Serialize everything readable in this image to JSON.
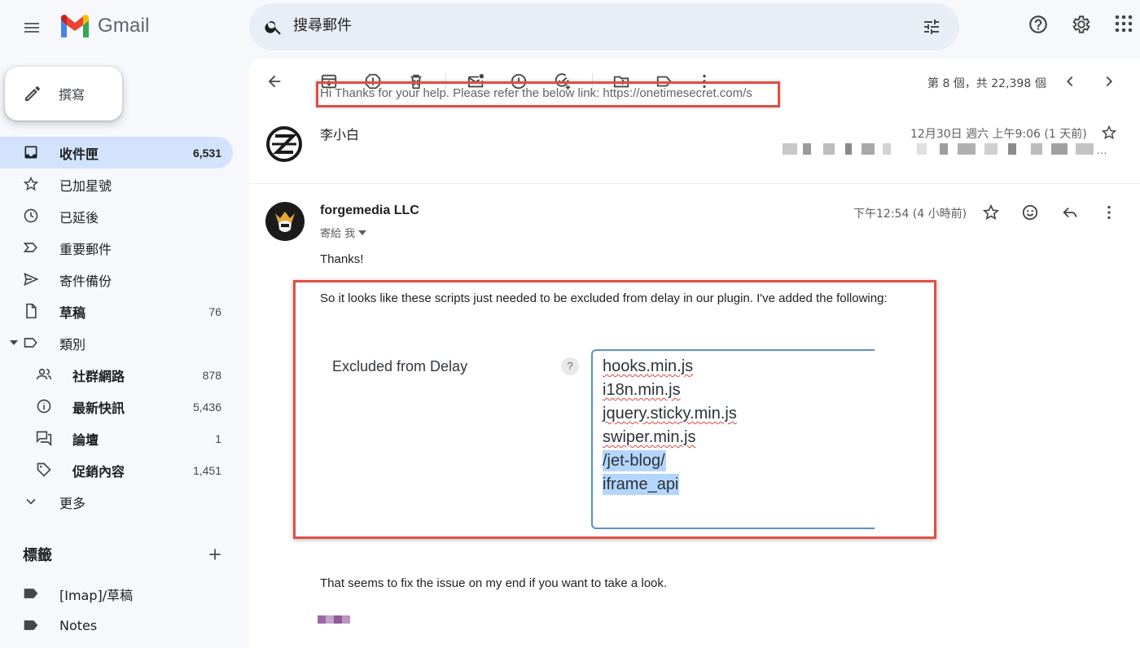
{
  "app": {
    "name": "Gmail"
  },
  "search": {
    "placeholder": "搜尋郵件"
  },
  "compose": {
    "label": "撰寫"
  },
  "sidebar": {
    "items": [
      {
        "label": "收件匣",
        "count": "6,531",
        "icon": "inbox-icon"
      },
      {
        "label": "已加星號",
        "count": "",
        "icon": "star-icon"
      },
      {
        "label": "已延後",
        "count": "",
        "icon": "clock-icon"
      },
      {
        "label": "重要郵件",
        "count": "",
        "icon": "important-icon"
      },
      {
        "label": "寄件備份",
        "count": "",
        "icon": "send-icon"
      },
      {
        "label": "草稿",
        "count": "76",
        "icon": "draft-icon"
      },
      {
        "label": "類別",
        "count": "",
        "icon": "label-icon"
      },
      {
        "label": "社群網路",
        "count": "878",
        "icon": "people-icon"
      },
      {
        "label": "最新快訊",
        "count": "5,436",
        "icon": "info-icon"
      },
      {
        "label": "論壇",
        "count": "1",
        "icon": "forum-icon"
      },
      {
        "label": "促銷內容",
        "count": "1,451",
        "icon": "tag-icon"
      },
      {
        "label": "更多",
        "count": "",
        "icon": "chevron-down-icon"
      }
    ],
    "labels_heading": "標籤",
    "labels": [
      {
        "label": "[Imap]/草稿"
      },
      {
        "label": "Notes"
      }
    ]
  },
  "toolbar": {
    "pager": "第 8 個，共 22,398 個"
  },
  "thread": {
    "collapsed": {
      "sender": "李小白",
      "date": "12月30日 週六 上午9:06 (1 天前)",
      "snippet": "Hi Thanks for your help. Please refer the below link: https://onetimesecret.com/s"
    },
    "message": {
      "sender": "forgemedia LLC",
      "to": "寄給 我",
      "date": "下午12:54 (4 小時前)",
      "greeting": "Thanks!",
      "intro": "So it looks like these scripts just needed to be excluded from delay in our plugin. I've added the following:",
      "setting_label": "Excluded from Delay",
      "help": "?",
      "scripts": [
        "hooks.min.js",
        "i18n.min.js",
        "jquery.sticky.min.js",
        "swiper.min.js",
        "/jet-blog/",
        "iframe_api"
      ],
      "closing": "That seems to fix the issue on my end if you want to take a look."
    }
  },
  "colors": {
    "accent": "#0b57d0",
    "highlight_box": "#e04f45",
    "active_nav": "#d3e3fd"
  }
}
